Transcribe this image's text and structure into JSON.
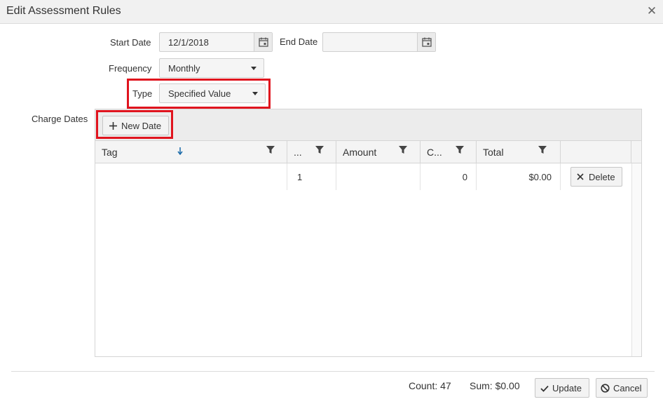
{
  "dialog": {
    "title": "Edit Assessment Rules"
  },
  "form": {
    "start_date_label": "Start Date",
    "start_date_value": "12/1/2018",
    "end_date_label": "End Date",
    "end_date_value": "",
    "frequency_label": "Frequency",
    "frequency_value": "Monthly",
    "type_label": "Type",
    "type_value": "Specified Value",
    "charge_dates_label": "Charge Dates"
  },
  "grid": {
    "new_date_label": "New Date",
    "columns": [
      "Tag",
      "...",
      "Amount",
      "C...",
      "Total"
    ],
    "rows": [
      {
        "tag": "",
        "col2": "1",
        "amount": "",
        "c": "0",
        "total": "$0.00",
        "action": "Delete"
      }
    ]
  },
  "footer": {
    "count": "Count: 47",
    "sum": "Sum: $0.00",
    "update_label": "Update",
    "cancel_label": "Cancel"
  },
  "colors": {
    "highlight": "#e0141e",
    "sort_arrow": "#1a6aa8"
  }
}
